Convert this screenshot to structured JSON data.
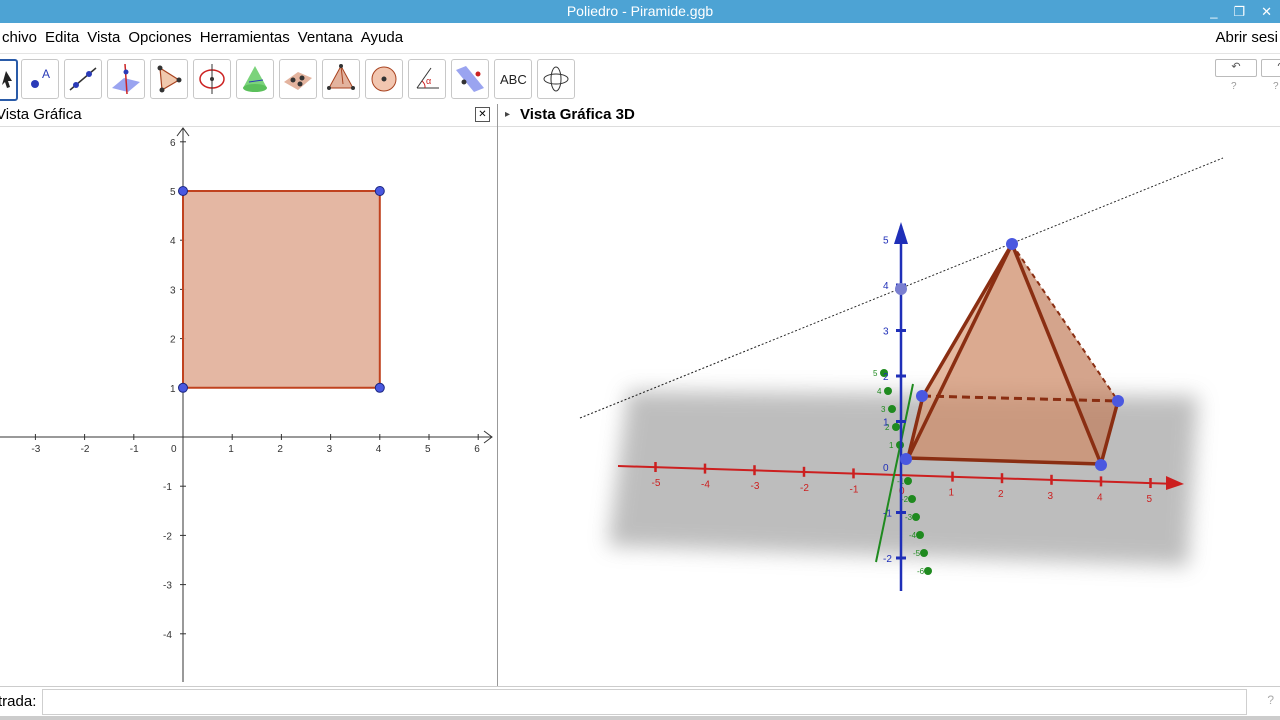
{
  "window": {
    "title": "Poliedro - Piramide.ggb",
    "minimize": "_",
    "maximize": "❐",
    "close": "✕"
  },
  "menu": {
    "items": [
      "chivo",
      "Edita",
      "Vista",
      "Opciones",
      "Herramientas",
      "Ventana",
      "Ayuda"
    ],
    "login": "Abrir sesi"
  },
  "toolbar": {
    "tools": [
      "move-tool-icon",
      "point-tool-icon",
      "line-tool-icon",
      "perpendicular-line-tool-icon",
      "polygon-tool-icon",
      "circle-axis-tool-icon",
      "cone-tool-icon",
      "plane-tool-icon",
      "pyramid-tool-icon",
      "sphere-tool-icon",
      "angle-tool-icon",
      "reflect-tool-icon",
      "text-tool-icon",
      "rotate-view-tool-icon"
    ],
    "text_tool_label": "ABC",
    "undo": "↶",
    "redo": "↷",
    "help": "?"
  },
  "graphics2d": {
    "title": "Vista Gráfica",
    "close": "✕",
    "x_ticks": [
      "-3",
      "-2",
      "-1",
      "0",
      "1",
      "2",
      "3",
      "4",
      "5",
      "6"
    ],
    "y_ticks": [
      "6",
      "5",
      "4",
      "3",
      "2",
      "1",
      "-1",
      "-2",
      "-3",
      "-4"
    ],
    "polygon_points": [
      [
        0,
        1
      ],
      [
        4,
        1
      ],
      [
        4,
        5
      ],
      [
        0,
        5
      ]
    ]
  },
  "graphics3d": {
    "title": "Vista Gráfica 3D",
    "x_ticks": [
      "-5",
      "-4",
      "-3",
      "-2",
      "-1",
      "0",
      "1",
      "2",
      "3",
      "4",
      "5"
    ],
    "z_ticks": [
      "5",
      "4",
      "3",
      "2",
      "1",
      "0",
      "-1",
      "-2"
    ],
    "y_ticks": [
      "5",
      "4",
      "3",
      "2",
      "1",
      "-1",
      "-2",
      "-3",
      "-4",
      "-5",
      "-6"
    ]
  },
  "input": {
    "label": "trada:",
    "value": "",
    "help": "?"
  },
  "colors": {
    "titlebar": "#4da3d4",
    "polygon_fill": "#e3b39e",
    "polygon_edge": "#a8421f",
    "point": "#4a58e0",
    "x_axis_3d": "#cc1f1f",
    "y_axis_3d": "#1f8a1f",
    "z_axis_3d": "#1f2fb8"
  }
}
